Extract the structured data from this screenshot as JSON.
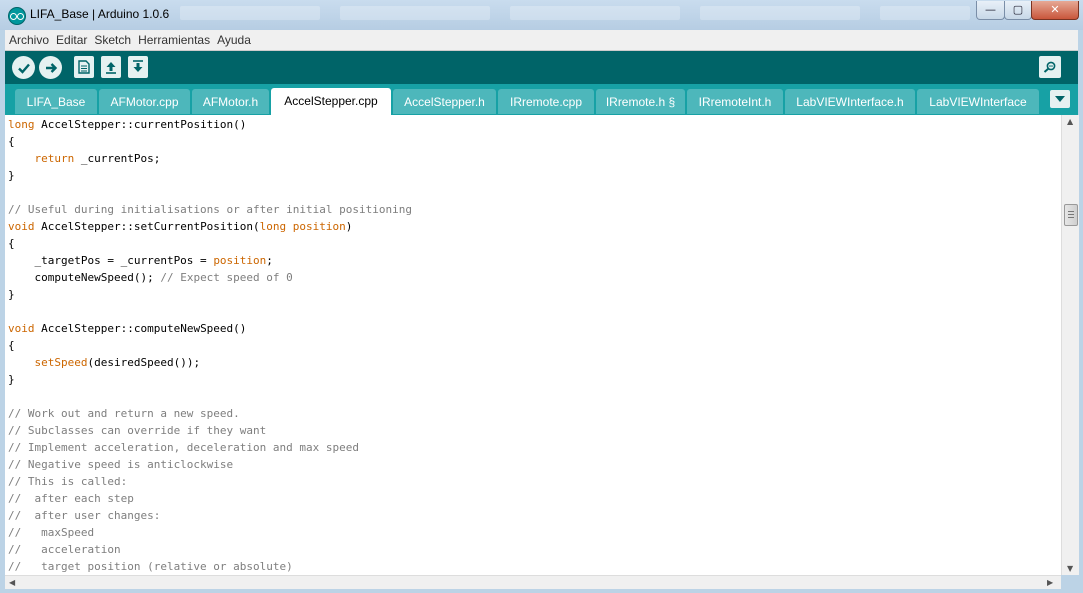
{
  "window": {
    "title": "LIFA_Base | Arduino 1.0.6",
    "minimize_glyph": "—",
    "maximize_glyph": "▢",
    "close_glyph": "✕"
  },
  "menu": [
    "Archivo",
    "Editar",
    "Sketch",
    "Herramientas",
    "Ayuda"
  ],
  "toolbar": {
    "icons": [
      "verify-icon",
      "upload-icon",
      "new-icon",
      "open-icon",
      "save-icon",
      "serial-monitor-icon"
    ]
  },
  "tabs": [
    {
      "label": "LIFA_Base",
      "active": false
    },
    {
      "label": "AFMotor.cpp",
      "active": false
    },
    {
      "label": "AFMotor.h",
      "active": false
    },
    {
      "label": "AccelStepper.cpp",
      "active": true
    },
    {
      "label": "AccelStepper.h",
      "active": false
    },
    {
      "label": "IRremote.cpp",
      "active": false
    },
    {
      "label": "IRremote.h §",
      "active": false
    },
    {
      "label": "IRremoteInt.h",
      "active": false
    },
    {
      "label": "LabVIEWInterface.h",
      "active": false
    },
    {
      "label": "LabVIEWInterface",
      "active": false
    }
  ],
  "colors": {
    "toolbar": "#006468",
    "tabbar": "#17a1a5",
    "tab": "#4db7bb",
    "keyword": "#cc6600",
    "comment": "#7e7e7e"
  },
  "code_lines": [
    [
      {
        "t": "long",
        "c": "kw"
      },
      {
        "t": " AccelStepper::currentPosition()"
      }
    ],
    [
      {
        "t": "{"
      }
    ],
    [
      {
        "t": "    "
      },
      {
        "t": "return",
        "c": "kw"
      },
      {
        "t": " _currentPos;"
      }
    ],
    [
      {
        "t": "}"
      }
    ],
    [],
    [
      {
        "t": "// Useful during initialisations or after initial positioning",
        "c": "cm"
      }
    ],
    [
      {
        "t": "void",
        "c": "kw"
      },
      {
        "t": " AccelStepper::setCurrentPosition("
      },
      {
        "t": "long",
        "c": "kw"
      },
      {
        "t": " "
      },
      {
        "t": "position",
        "c": "kw"
      },
      {
        "t": ")"
      }
    ],
    [
      {
        "t": "{"
      }
    ],
    [
      {
        "t": "    _targetPos = _currentPos = "
      },
      {
        "t": "position",
        "c": "kw"
      },
      {
        "t": ";"
      }
    ],
    [
      {
        "t": "    computeNewSpeed(); "
      },
      {
        "t": "// Expect speed of 0",
        "c": "cm"
      }
    ],
    [
      {
        "t": "}"
      }
    ],
    [],
    [
      {
        "t": "void",
        "c": "kw"
      },
      {
        "t": " AccelStepper::computeNewSpeed()"
      }
    ],
    [
      {
        "t": "{"
      }
    ],
    [
      {
        "t": "    "
      },
      {
        "t": "setSpeed",
        "c": "fn"
      },
      {
        "t": "(desiredSpeed());"
      }
    ],
    [
      {
        "t": "}"
      }
    ],
    [],
    [
      {
        "t": "// Work out and return a new speed.",
        "c": "cm"
      }
    ],
    [
      {
        "t": "// Subclasses can override if they want",
        "c": "cm"
      }
    ],
    [
      {
        "t": "// Implement acceleration, deceleration and max speed",
        "c": "cm"
      }
    ],
    [
      {
        "t": "// Negative speed is anticlockwise",
        "c": "cm"
      }
    ],
    [
      {
        "t": "// This is called:",
        "c": "cm"
      }
    ],
    [
      {
        "t": "//  after each step",
        "c": "cm"
      }
    ],
    [
      {
        "t": "//  after user changes:",
        "c": "cm"
      }
    ],
    [
      {
        "t": "//   maxSpeed",
        "c": "cm"
      }
    ],
    [
      {
        "t": "//   acceleration",
        "c": "cm"
      }
    ],
    [
      {
        "t": "//   target position (relative or absolute)",
        "c": "cm"
      }
    ]
  ]
}
